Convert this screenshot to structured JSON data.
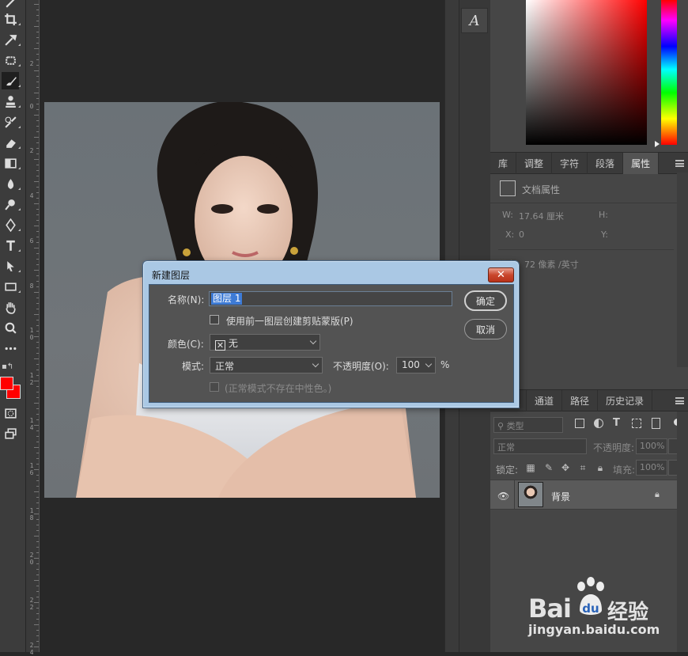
{
  "canvas": {
    "photo_alt": ""
  },
  "ruler": {
    "numbers": [
      "2",
      "0",
      "2",
      "4",
      "6",
      "8",
      "1 0",
      "1 2",
      "1 4",
      "1 6",
      "1 8",
      "2 0",
      "2 2",
      "2 4"
    ]
  },
  "panels": {
    "top_tabs": [
      "库",
      "调整",
      "字符",
      "段落",
      "属性"
    ],
    "active_top_tab": "属性",
    "properties": {
      "header": "文档属性",
      "w_label": "W:",
      "w_value": "17.64 厘米",
      "h_label": "H:",
      "x_label": "X:",
      "x_value": "0",
      "y_label": "Y:",
      "resolution": "辨率：72 像素 /英寸"
    },
    "bottom_tabs": [
      "通道",
      "路径",
      "历史记录"
    ],
    "layers": {
      "filter_label": "类型",
      "blend_mode": "正常",
      "opacity_label": "不透明度:",
      "opacity_value": "100%",
      "lock_label": "锁定:",
      "fill_label": "填充:",
      "fill_value": "100%",
      "layer_name": "背景"
    }
  },
  "dialog": {
    "title": "新建图层",
    "close": "✕",
    "name_label": "名称(N):",
    "name_value": "图层 1",
    "clipping_label": "使用前一图层创建剪贴蒙版(P)",
    "color_label": "颜色(C):",
    "color_value": "无",
    "mode_label": "模式:",
    "mode_value": "正常",
    "opacity_label": "不透明度(O):",
    "opacity_value": "100",
    "opacity_unit": "%",
    "neutral_label": "(正常模式不存在中性色。)",
    "ok": "确定",
    "cancel": "取消"
  },
  "watermark": {
    "brand": "Bai",
    "brand2": "经验",
    "url": "jingyan.baidu.com"
  },
  "colors": {
    "foreground": "#ff0000",
    "background": "#ff0000",
    "selection": "#3d7bd6"
  }
}
